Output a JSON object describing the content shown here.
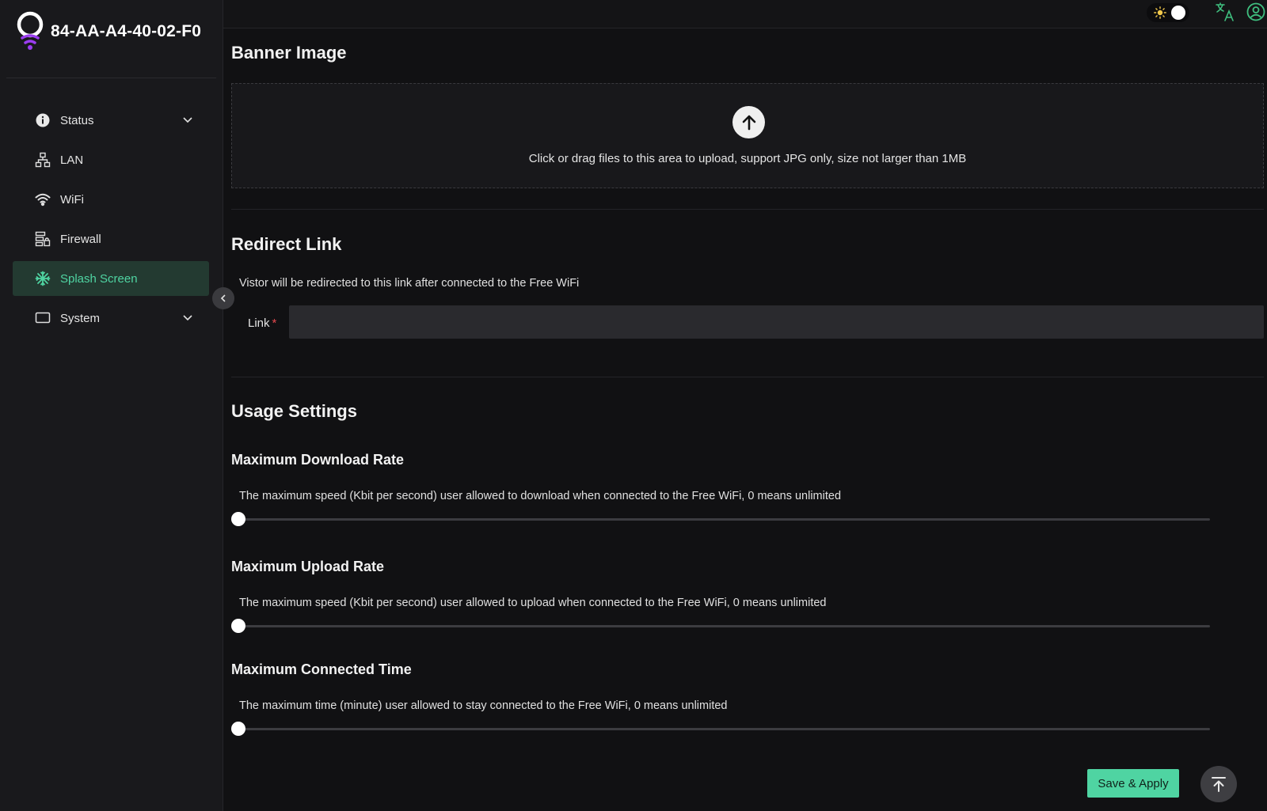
{
  "header": {
    "device_name": "84-AA-A4-40-02-F0"
  },
  "sidebar": {
    "items": [
      {
        "label": "Status",
        "icon": "info-icon",
        "expandable": true
      },
      {
        "label": "LAN",
        "icon": "network-icon",
        "expandable": false
      },
      {
        "label": "WiFi",
        "icon": "wifi-icon",
        "expandable": false
      },
      {
        "label": "Firewall",
        "icon": "firewall-icon",
        "expandable": false
      },
      {
        "label": "Splash Screen",
        "icon": "splash-icon",
        "expandable": false,
        "active": true
      },
      {
        "label": "System",
        "icon": "monitor-icon",
        "expandable": true
      }
    ]
  },
  "topbar": {
    "theme": "dark",
    "icons": [
      "sun-icon",
      "translate-icon",
      "user-icon"
    ]
  },
  "banner": {
    "title": "Banner Image",
    "upload_text": "Click or drag files to this area to upload, support JPG only, size not larger than 1MB"
  },
  "redirect": {
    "title": "Redirect Link",
    "description": "Vistor will be redirected to this link after connected to the Free WiFi",
    "link_label": "Link",
    "required_mark": "*",
    "link_value": ""
  },
  "usage": {
    "title": "Usage Settings",
    "download": {
      "title": "Maximum Download Rate",
      "description": "The maximum speed (Kbit per second) user allowed to download when connected to the Free WiFi, 0 means unlimited",
      "value": 0
    },
    "upload": {
      "title": "Maximum Upload Rate",
      "description": "The maximum speed (Kbit per second) user allowed to upload when connected to the Free WiFi, 0 means unlimited",
      "value": 0
    },
    "time": {
      "title": "Maximum Connected Time",
      "description": "The maximum time (minute) user allowed to stay connected to the Free WiFi, 0 means unlimited",
      "value": 0
    }
  },
  "actions": {
    "save_label": "Save & Apply"
  },
  "colors": {
    "accent": "#4fd4a2",
    "active_bg": "#233a31",
    "background": "#111113",
    "sidebar": "#19191c",
    "required": "#e5484d",
    "logo_purple": "#9b3df0"
  }
}
